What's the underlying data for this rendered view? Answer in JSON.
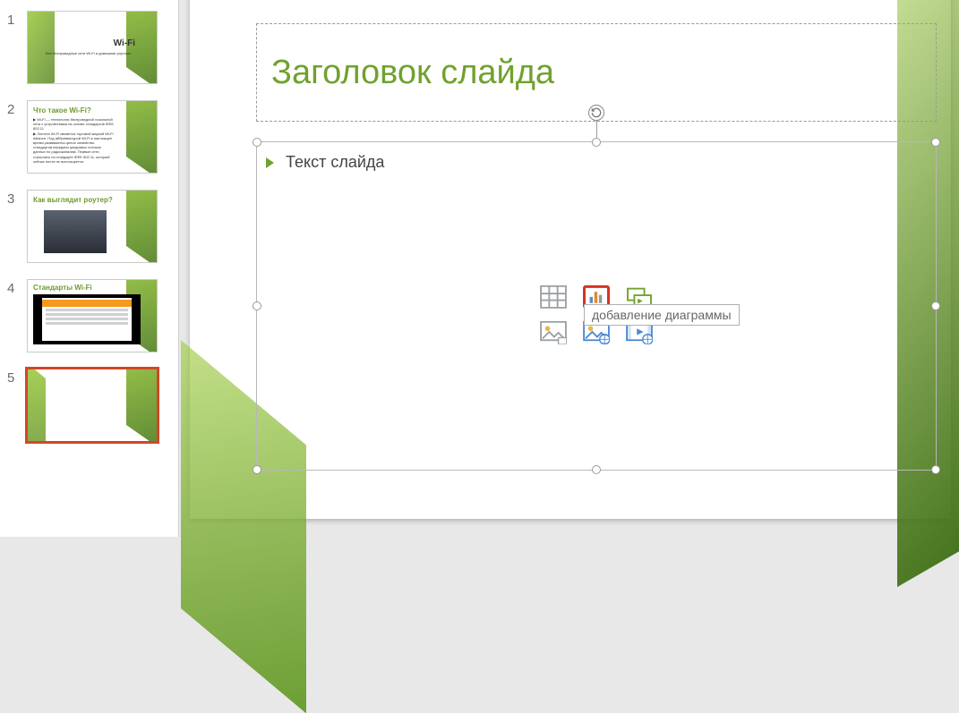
{
  "thumbnails": [
    {
      "num": "1",
      "title": "Wi-Fi",
      "body": "Все беспроводные сети Wi-Fi и домашние роутеры."
    },
    {
      "num": "2",
      "title": "Что такое Wi-Fi?",
      "body": ""
    },
    {
      "num": "3",
      "title": "Как выглядит роутер?",
      "body": ""
    },
    {
      "num": "4",
      "title": "Стандарты Wi-Fi",
      "body": ""
    },
    {
      "num": "5",
      "title": "",
      "body": ""
    }
  ],
  "slide": {
    "title_placeholder": "Заголовок слайда",
    "body_placeholder": "Текст слайда"
  },
  "tooltip": "добавление диаграммы",
  "icons": {
    "table": "insert-table",
    "chart": "insert-chart",
    "smartart": "insert-smartart",
    "picture": "insert-picture",
    "online_picture": "insert-online-picture",
    "video": "insert-video"
  }
}
